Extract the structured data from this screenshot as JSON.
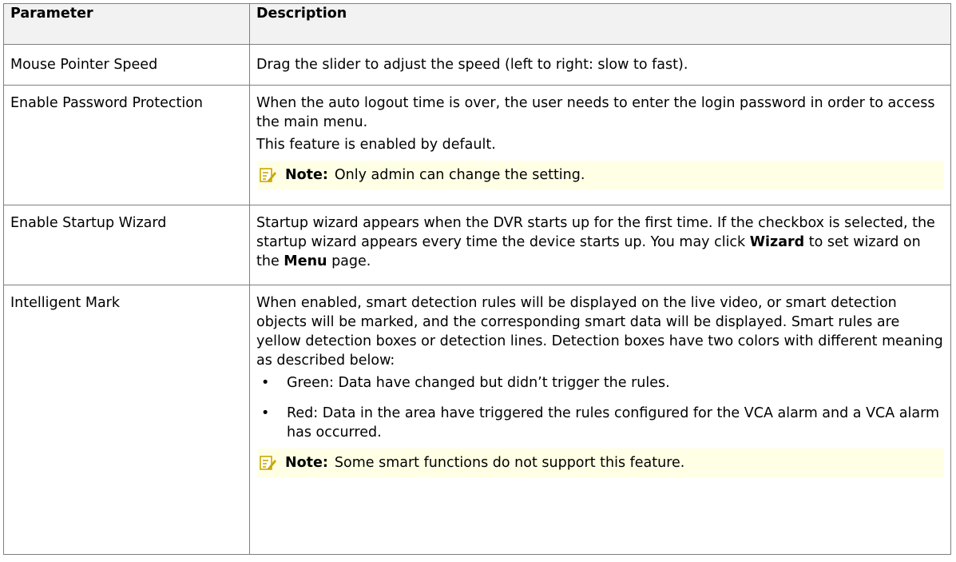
{
  "table": {
    "header": {
      "param": "Parameter",
      "desc": "Description"
    },
    "rows": [
      {
        "param": "Mouse Pointer Speed",
        "desc": "Drag the slider to adjust the speed (left to right: slow to fast)."
      },
      {
        "param": "Enable Password Protection",
        "desc_line1": "When the auto logout time is over, the user needs to enter the login password in order to access the main menu.",
        "desc_line2": "This feature is enabled by default.",
        "note_label": "Note:",
        "note_text": "Only admin can change the setting."
      },
      {
        "param": "Enable Startup Wizard",
        "desc_a": "Startup wizard appears when the DVR starts up for the first time. If the checkbox is selected, the startup wizard appears every time the device starts up. You may click ",
        "desc_b": "Wizard",
        "desc_c": " to set wizard on the ",
        "desc_d": "Menu",
        "desc_e": " page."
      },
      {
        "param": "Intelligent Mark",
        "desc": "When enabled, smart detection rules will be displayed on the live video, or smart detection objects will be marked, and the corresponding smart data will be displayed. Smart rules are yellow detection boxes or detection lines. Detection boxes have two colors with different meaning as described below:",
        "bullet_symbol": "•",
        "bullet1": "Green: Data have changed but didn’t trigger the rules.",
        "bullet2": "Red: Data in the area have triggered the rules configured for the VCA alarm and a VCA alarm has occurred.",
        "note_label": "Note:",
        "note_text": "Some smart functions do not support this feature."
      }
    ]
  },
  "colors": {
    "border": "#7f7f7f",
    "header_bg": "#f2f2f2",
    "note_bg": "#ffffe5",
    "note_icon": "#c9a800"
  },
  "icons": {
    "note": "note-pencil-icon"
  }
}
